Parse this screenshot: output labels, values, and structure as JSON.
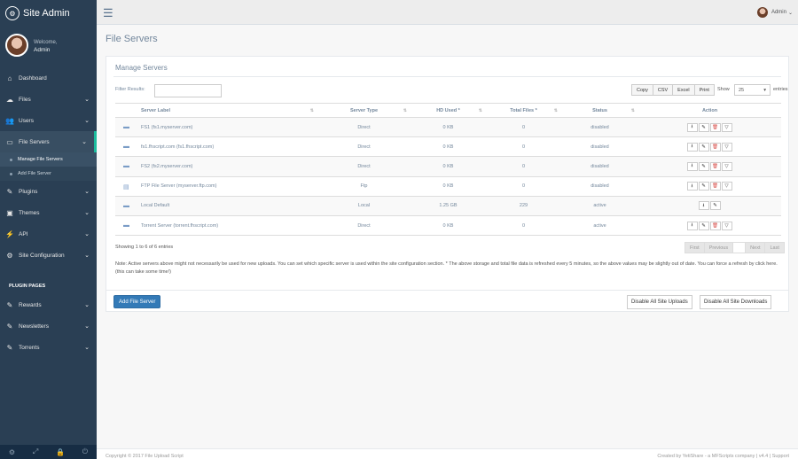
{
  "sidebar": {
    "title": "Site Admin",
    "welcome": "Welcome,",
    "username": "Admin",
    "nav": [
      {
        "label": "Dashboard",
        "icon": "home-icon"
      },
      {
        "label": "Files",
        "icon": "cloud-upload-icon"
      },
      {
        "label": "Users",
        "icon": "users-icon"
      },
      {
        "label": "File Servers",
        "icon": "folder-icon"
      },
      {
        "label": "Plugins",
        "icon": "plugin-icon"
      },
      {
        "label": "Themes",
        "icon": "image-icon"
      },
      {
        "label": "API",
        "icon": "plug-icon"
      },
      {
        "label": "Site Configuration",
        "icon": "gear-icon"
      }
    ],
    "sub": [
      "Manage File Servers",
      "Add File Server"
    ],
    "section": "PLUGIN PAGES",
    "plugin_nav": [
      "Rewards",
      "Newsletters",
      "Torrents"
    ]
  },
  "topnav": {
    "user": "Admin"
  },
  "page": {
    "title": "File Servers"
  },
  "panel": {
    "title": "Manage Servers",
    "filter_label": "Filter Results:",
    "buttons": [
      "Copy",
      "CSV",
      "Excel",
      "Print"
    ],
    "show_label": "Show",
    "show_value": "25",
    "entries_label": "entries",
    "columns": [
      "Server Label",
      "Server Type",
      "HD Used *",
      "Total Files *",
      "Status",
      "Action"
    ],
    "rows": [
      {
        "label": "FS1 (fs1.myserver.com)",
        "type": "Direct",
        "hd": "0 KB",
        "files": "0",
        "status": "disabled"
      },
      {
        "label": "fs1.fhscript.com (fs1.fhscript.com)",
        "type": "Direct",
        "hd": "0 KB",
        "files": "0",
        "status": "disabled"
      },
      {
        "label": "FS2 (fs2.myserver.com)",
        "type": "Direct",
        "hd": "0 KB",
        "files": "0",
        "status": "disabled"
      },
      {
        "label": "FTP File Server (myserver.ftp.com)",
        "type": "Ftp",
        "hd": "0 KB",
        "files": "0",
        "status": "disabled"
      },
      {
        "label": "Local Default",
        "type": "Local",
        "hd": "1.25 GB",
        "files": "229",
        "status": "active"
      },
      {
        "label": "Torrent Server (torrent.fhscript.com)",
        "type": "Direct",
        "hd": "0 KB",
        "files": "0",
        "status": "active"
      }
    ],
    "showing": "Showing 1 to 6 of 6 entries",
    "pager": [
      "First",
      "Previous",
      "1",
      "Next",
      "Last"
    ],
    "note": "Note: Active servers above might not necessarily be used for new uploads. You can set which specific server is used within the site configuration section. * The above storage and total file data is refreshed every 5 minutes, so the above values may be slightly out of date. You can force a refresh by click here. (this can take some time!)"
  },
  "bottom": {
    "add": "Add File Server",
    "disable_uploads": "Disable All Site Uploads",
    "disable_downloads": "Disable All Site Downloads"
  },
  "footer": {
    "left": "Copyright © 2017 File Upload Script",
    "right": "Created by YetiShare - a MFScripts company | v4.4 | Support"
  }
}
